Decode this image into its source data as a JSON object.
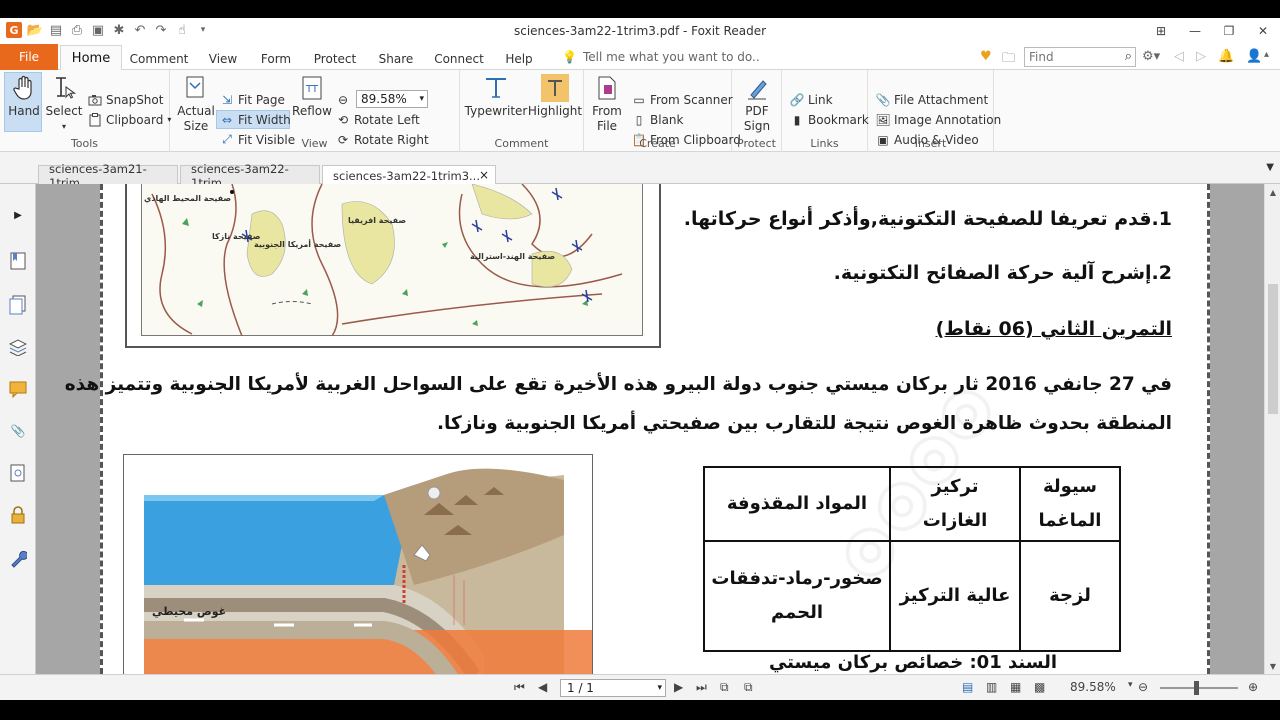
{
  "window": {
    "title": "sciences-3am22-1trim3.pdf - Foxit Reader"
  },
  "tabs": {
    "file": "File",
    "home": "Home",
    "comment": "Comment",
    "view": "View",
    "form": "Form",
    "protect": "Protect",
    "share": "Share",
    "connect": "Connect",
    "help": "Help",
    "tell_me": "Tell me what you want to do..",
    "find_placeholder": "Find"
  },
  "ribbon": {
    "tools": {
      "hand": "Hand",
      "select": "Select",
      "snapshot": "SnapShot",
      "clipboard": "Clipboard",
      "label": "Tools"
    },
    "view": {
      "actual_size_1": "Actual",
      "actual_size_2": "Size",
      "fit_page": "Fit Page",
      "fit_width": "Fit Width",
      "fit_visible": "Fit Visible",
      "reflow": "Reflow",
      "zoom": "89.58%",
      "rotate_left": "Rotate Left",
      "rotate_right": "Rotate Right",
      "label": "View"
    },
    "comment": {
      "typewriter": "Typewriter",
      "highlight": "Highlight",
      "label": "Comment"
    },
    "create": {
      "from_file_1": "From",
      "from_file_2": "File",
      "from_scanner": "From Scanner",
      "blank": "Blank",
      "from_clipboard": "From Clipboard",
      "label": "Create"
    },
    "protect": {
      "pdf_sign_1": "PDF",
      "pdf_sign_2": "Sign",
      "label": "Protect"
    },
    "links": {
      "link": "Link",
      "bookmark": "Bookmark",
      "label": "Links"
    },
    "insert": {
      "file_attachment": "File Attachment",
      "image_annotation": "Image Annotation",
      "audio_video": "Audio & Video",
      "label": "Insert"
    }
  },
  "doc_tabs": [
    {
      "label": "sciences-3am21-1trim..."
    },
    {
      "label": "sciences-3am22-1trim..."
    },
    {
      "label": "sciences-3am22-1trim3...",
      "close": "×"
    }
  ],
  "document": {
    "q1": "1.قدم تعريفا للصفيحة التكتونية,وأذكر أنواع حركاتها.",
    "q2": "2.إشرح آلية حركة الصفائح التكتونية.",
    "exercise2": "التمرين الثاني (06 نقاط)",
    "para_line1": "في 27 جانفي 2016 ثار بركان ميستي جنوب دولة البيرو هذه الأخيرة تقع على السواحل الغربية لأمريكا الجنوبية وتتميز هذه",
    "para_line2": "المنطقة بحدوث ظاهرة الغوص نتيجة للتقارب بين صفيحتي أمريكا الجنوبية ونازكا.",
    "diagram_label": "غوص محيطي",
    "sanad": "السند 01: خصائص بركان ميستي",
    "map_labels": {
      "pacific": "صفيحة المحيط الهادي",
      "nazca": "صفيحة نازكا",
      "south_america": "صفيحة أمريكا الجنوبية",
      "africa": "صفيحة افريقيا",
      "indo_australia": "صفيحة الهند-استرالية"
    },
    "table": {
      "headers": [
        "سيولة الماغما",
        "تركيز الغازات",
        "المواد المقذوفة"
      ],
      "row": [
        "لزجة",
        "عالية التركيز",
        "صخور-رماد-تدفقات الحمم"
      ]
    }
  },
  "status": {
    "page": "1 / 1",
    "zoom": "89.58%"
  }
}
